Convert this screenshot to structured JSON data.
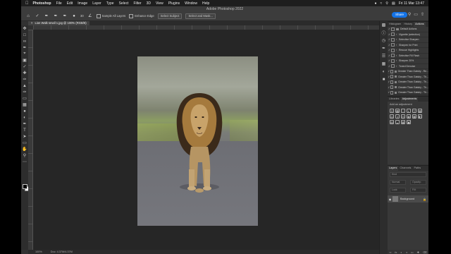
{
  "menubar": {
    "app": "Photoshop",
    "items": [
      "File",
      "Edit",
      "Image",
      "Layer",
      "Type",
      "Select",
      "Filter",
      "3D",
      "View",
      "Plugins",
      "Window",
      "Help"
    ],
    "clock": "Fri 11 Mar  13:47"
  },
  "window": {
    "title": "Adobe Photoshop 2022"
  },
  "options": {
    "brush_size": "30",
    "sample_all_layers": "Sample All Layers",
    "enhance_edge": "Enhance Edge",
    "select_subject": "Select Subject",
    "select_and_mask": "Select and Mask...",
    "share_label": "Share"
  },
  "document": {
    "tab_title": "Lion Walk small 1.jpg @ 100% (RGB/8)"
  },
  "status": {
    "zoom": "100%",
    "doc_info": "Doc: 4.37M/4.37M"
  },
  "actions_panel": {
    "tabs": [
      "Histogram",
      "History",
      "Actions"
    ],
    "active_tab": "Actions",
    "items": [
      {
        "label": "Default Actions",
        "type": "folder",
        "checked": true
      },
      {
        "label": "Vignette (selection)",
        "type": "action",
        "checked": true
      },
      {
        "label": "Selective Sharpen",
        "type": "action",
        "checked": true
      },
      {
        "label": "Sharpen for Print",
        "type": "action",
        "checked": true
      },
      {
        "label": "Rescue Highlights",
        "type": "action",
        "checked": true
      },
      {
        "label": "Selective Fill Flash",
        "type": "action",
        "checked": true
      },
      {
        "label": "Sharpen 20%",
        "type": "action",
        "checked": true
      },
      {
        "label": "Toned Denoise",
        "type": "action",
        "checked": true
      },
      {
        "label": "Greater Than Gatsby - Re...",
        "type": "folder",
        "checked": true
      },
      {
        "label": "Greater Than Gatsby - Th...",
        "type": "folder",
        "checked": true
      },
      {
        "label": "Greater Than Gatsby - Th...",
        "type": "folder",
        "checked": true
      },
      {
        "label": "Greater Than Gatsby - Th...",
        "type": "folder",
        "checked": true
      },
      {
        "label": "Greater Than Gatsby - Th...",
        "type": "folder",
        "checked": true
      }
    ]
  },
  "adjustments_panel": {
    "tabs": [
      "Libraries",
      "Adjustments"
    ],
    "active_tab": "Adjustments",
    "hint": "Add an adjustment"
  },
  "layers_panel": {
    "tabs": [
      "Layers",
      "Channels",
      "Paths"
    ],
    "active_tab": "Layers",
    "kind_placeholder": "Kind",
    "blend_mode": "Normal",
    "opacity_label": "Opacity:",
    "lock_label": "Lock:",
    "fill_label": "Fill:",
    "layers": [
      {
        "name": "Background",
        "locked": true,
        "visible": true
      }
    ]
  }
}
